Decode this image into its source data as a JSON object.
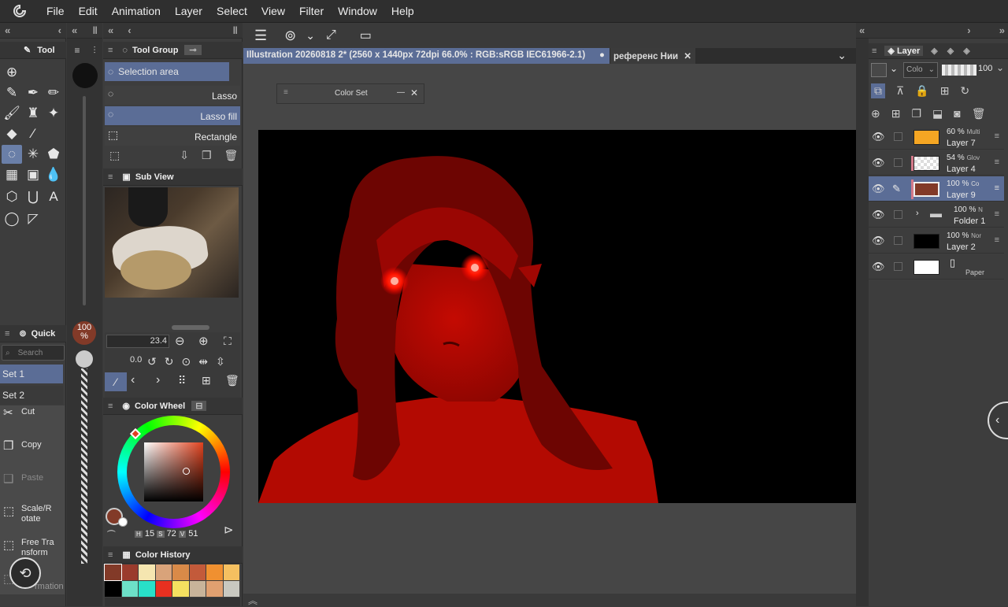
{
  "menu": {
    "items": [
      "File",
      "Edit",
      "Animation",
      "Layer",
      "Select",
      "View",
      "Filter",
      "Window",
      "Help"
    ]
  },
  "tool_panel": {
    "title": "Tool"
  },
  "tool_group": {
    "title": "Tool Group",
    "selected_label": "Selection area",
    "items": [
      "Lasso",
      "Lasso fill",
      "Rectangle"
    ]
  },
  "sub_view": {
    "title": "Sub View"
  },
  "brush": {
    "size": "23.4",
    "angle": "0.0",
    "opacity": "100",
    "opacity_unit": "%"
  },
  "quick_access": {
    "title": "Quick",
    "search_placeholder": "Search",
    "sets": [
      "Set 1",
      "Set 2"
    ],
    "commands": [
      {
        "label": "Cut",
        "icon": "scissors-icon"
      },
      {
        "label": "Copy",
        "icon": "copy-icon"
      },
      {
        "label": "Paste",
        "icon": "paste-icon"
      },
      {
        "label": "Scale/R otate",
        "icon": "scale-rotate-icon"
      },
      {
        "label": "Free Tra nsform",
        "icon": "free-transform-icon"
      },
      {
        "label": "r rmation",
        "icon": "transform-icon"
      }
    ]
  },
  "color_wheel": {
    "title": "Color Wheel",
    "h_label": "H",
    "h": "15",
    "s_label": "S",
    "s": "72",
    "v_label": "V",
    "v": "51",
    "main_color": "#823a28"
  },
  "color_history": {
    "title": "Color History",
    "colors": [
      "#823a28",
      "#9a3b2c",
      "#f5e6b0",
      "#d9a37a",
      "#d98a48",
      "#c35a3a",
      "#f09030",
      "#f5c060",
      "#000000",
      "#6de0c8",
      "#28e0c8",
      "#e83020",
      "#f5e060",
      "#c8b49a",
      "#e0a070",
      "#c8c8c0"
    ]
  },
  "document": {
    "tab_title": "Illustration 20260818 2* (2560 x 1440px 72dpi 66.0% : RGB:sRGB IEC61966-2.1)",
    "tab2_title": "референс Нии"
  },
  "color_set": {
    "title": "Color Set"
  },
  "layer_panel": {
    "title": "Layer",
    "blend_mode": "Colo",
    "opacity": "100",
    "layers": [
      {
        "pct": "60 %",
        "mode": "Multi",
        "name": "Layer 7",
        "thumb": "#f5a623"
      },
      {
        "pct": "54 %",
        "mode": "Glov",
        "name": "Layer 4",
        "thumb": "checker"
      },
      {
        "pct": "100 %",
        "mode": "Co",
        "name": "Layer 9",
        "thumb": "#823a28"
      },
      {
        "pct": "100 %",
        "mode": "N",
        "name": "Folder 1",
        "thumb": "folder"
      },
      {
        "pct": "100 %",
        "mode": "Nor",
        "name": "Layer 2",
        "thumb": "#000000"
      },
      {
        "pct": "",
        "mode": "",
        "name": "Paper",
        "thumb": "#ffffff"
      }
    ]
  }
}
